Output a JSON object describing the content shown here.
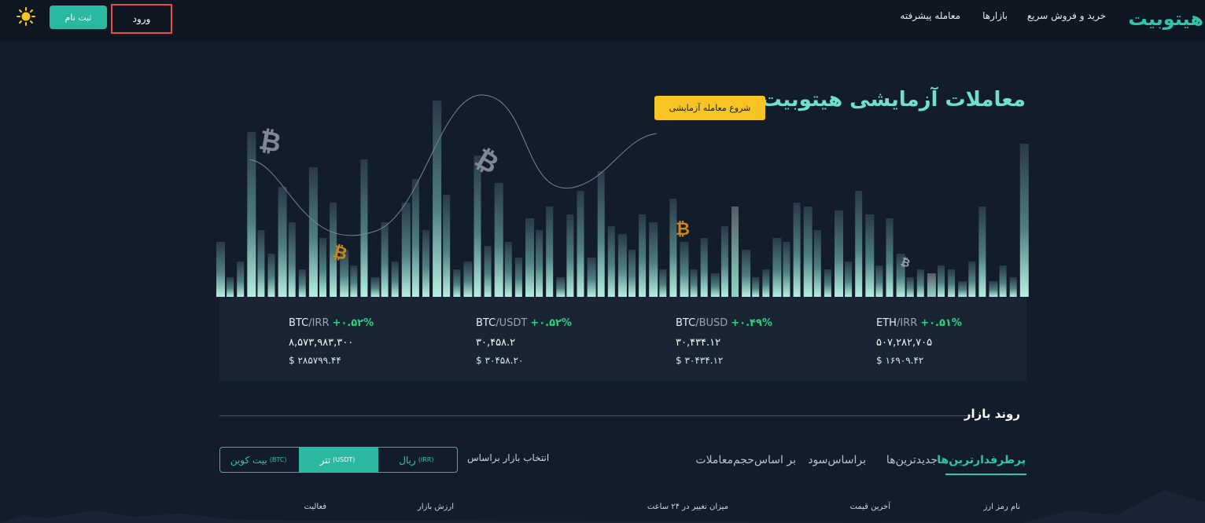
{
  "header": {
    "logo": "هیتوبیت",
    "nav": [
      "خرید و فروش سریع",
      "بازارها",
      "معامله پیشرفته"
    ],
    "register": "ثبت نام",
    "login": "ورود",
    "theme_icon": "sun-icon"
  },
  "hero": {
    "title": "معاملات آزمایشی هیتوبیت",
    "demo_button": "شروع معامله آزمایشی"
  },
  "tickers": [
    {
      "base": "BTC",
      "quote": "IRR",
      "change": "+۰.۵۲%",
      "price": "۸,۵۷۳,۹۸۳,۳۰۰",
      "usd": "$ ۲۸۵۷۹۹.۴۴"
    },
    {
      "base": "BTC",
      "quote": "USDT",
      "change": "+۰.۵۲%",
      "price": "۳۰,۴۵۸.۲",
      "usd": "$ ۳۰۴۵۸.۲۰"
    },
    {
      "base": "BTC",
      "quote": "BUSD",
      "change": "+۰.۴۹%",
      "price": "۳۰,۴۳۴.۱۲",
      "usd": "$ ۳۰۴۳۴.۱۲"
    },
    {
      "base": "ETH",
      "quote": "IRR",
      "change": "+۰.۵۱%",
      "price": "۵۰۷,۲۸۲,۷۰۵",
      "usd": "$ ۱۶۹۰۹.۴۲"
    }
  ],
  "market": {
    "title": "روند بازار",
    "tabs": [
      "پرطرفدارترین‌ها",
      "جدیدترین‌ها",
      "براساس‌سود",
      "بر اساس‌حجم‌معاملات"
    ],
    "select_label": "انتخاب بازار براساس",
    "segments": [
      {
        "label": "ریال",
        "code": "(IRR)"
      },
      {
        "label": "تتر",
        "code": "(USDT)"
      },
      {
        "label": "بیت کوین",
        "code": "(BTC)"
      }
    ],
    "columns": [
      "نام رمز ارز",
      "آخرین قیمت",
      "میزان تغییر در ۲۴ ساعت",
      "ارزش بازار",
      "فعالیت"
    ]
  },
  "colors": {
    "accent": "#2fc6a8",
    "positive": "#2ed17f",
    "demo": "#f6c523"
  }
}
